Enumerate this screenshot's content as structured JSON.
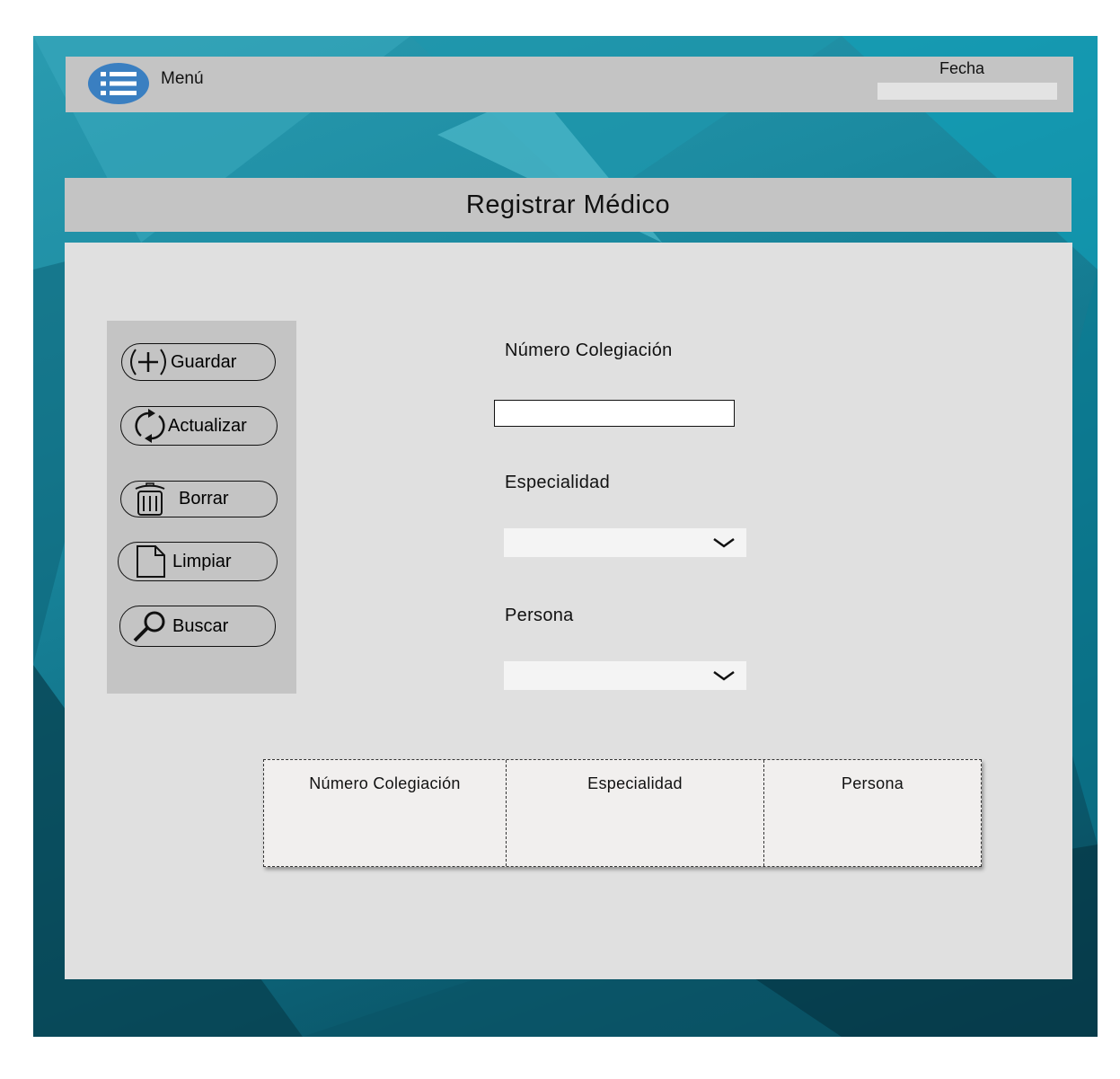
{
  "header": {
    "menu_label": "Menú",
    "date_label": "Fecha",
    "date_value": ""
  },
  "page": {
    "title": "Registrar Médico"
  },
  "actions": {
    "save_label": "Guardar",
    "update_label": "Actualizar",
    "delete_label": "Borrar",
    "clear_label": "Limpiar",
    "search_label": "Buscar"
  },
  "form": {
    "numero_label": "Número Colegiación",
    "numero_value": "",
    "especialidad_label": "Especialidad",
    "especialidad_value": "",
    "persona_label": "Persona",
    "persona_value": ""
  },
  "table": {
    "columns": [
      "Número Colegiación",
      "Especialidad",
      "Persona"
    ]
  },
  "colors": {
    "menu_icon": "#3a7fc1",
    "bar": "#c4c4c4",
    "panel": "#e0e0e0",
    "table_bg": "#f1efee",
    "background": "#1b8aa0"
  }
}
